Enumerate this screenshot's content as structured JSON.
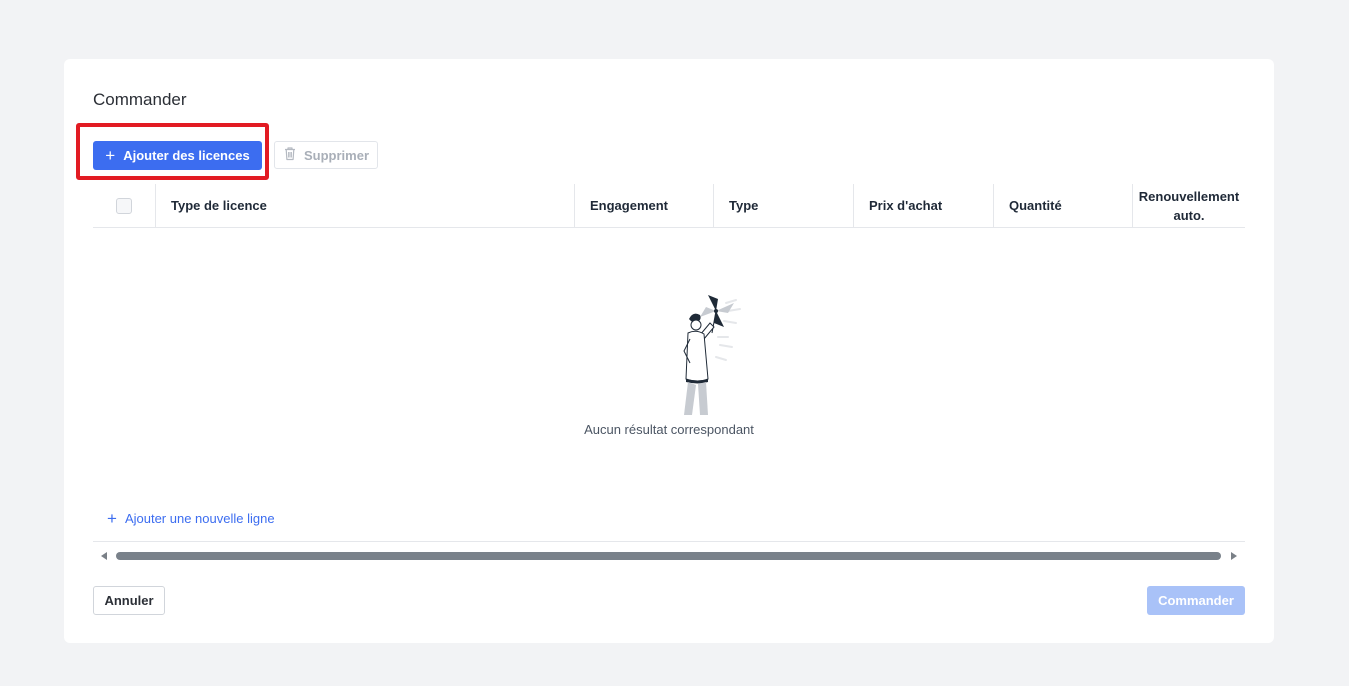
{
  "card": {
    "title": "Commander"
  },
  "toolbar": {
    "add_licenses_label": "Ajouter des licences",
    "delete_label": "Supprimer"
  },
  "table": {
    "columns": [
      "Type de licence",
      "Engagement",
      "Type",
      "Prix d'achat",
      "Quantité",
      "Renouvellement",
      "auto."
    ]
  },
  "empty_state": {
    "message": "Aucun résultat correspondant"
  },
  "add_row": {
    "label": "Ajouter une nouvelle ligne"
  },
  "footer": {
    "cancel_label": "Annuler",
    "order_label": "Commander"
  },
  "colors": {
    "primary": "#3c6df0",
    "primary_disabled": "#a9c2f8",
    "highlight": "#e21b23",
    "background": "#f2f3f5"
  },
  "icons": {
    "add": "plus-icon",
    "delete": "trash-icon",
    "empty": "empty-state-illustration"
  }
}
